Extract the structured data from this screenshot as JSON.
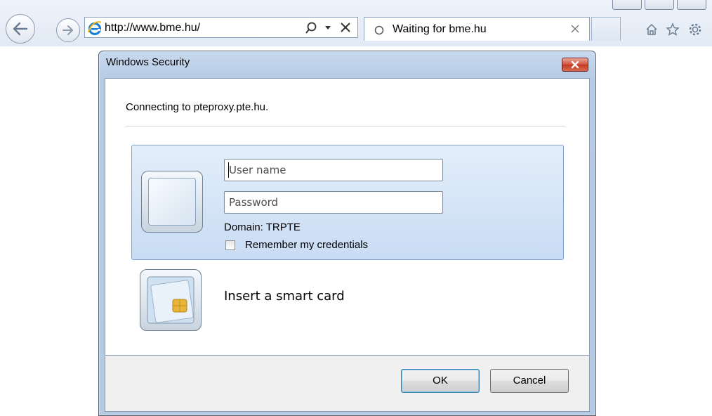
{
  "browser": {
    "address": {
      "url": "http://www.bme.hu/"
    },
    "tab": {
      "label": "Waiting for bme.hu"
    },
    "icons": [
      "back-icon",
      "forward-icon",
      "ie-logo-icon",
      "search-icon",
      "dropdown-icon",
      "stop-icon",
      "loading-icon",
      "close-icon",
      "home-icon",
      "favorites-icon",
      "tools-icon"
    ]
  },
  "dialog": {
    "title": "Windows Security",
    "message": "Connecting to pteproxy.pte.hu.",
    "credentials": {
      "username_placeholder": "User name",
      "username_value": "",
      "password_placeholder": "Password",
      "password_value": "",
      "domain": "Domain: TRPTE",
      "remember_label": "Remember my credentials",
      "remember_checked": false
    },
    "smartcard_label": "Insert a smart card",
    "buttons": {
      "ok": "OK",
      "cancel": "Cancel"
    }
  },
  "colors": {
    "dialog_frame": "#b6cbe4",
    "close_button": "#c5391f",
    "selected_tile": "#c8dcf4",
    "ok_focus": "#3c7fb1"
  }
}
